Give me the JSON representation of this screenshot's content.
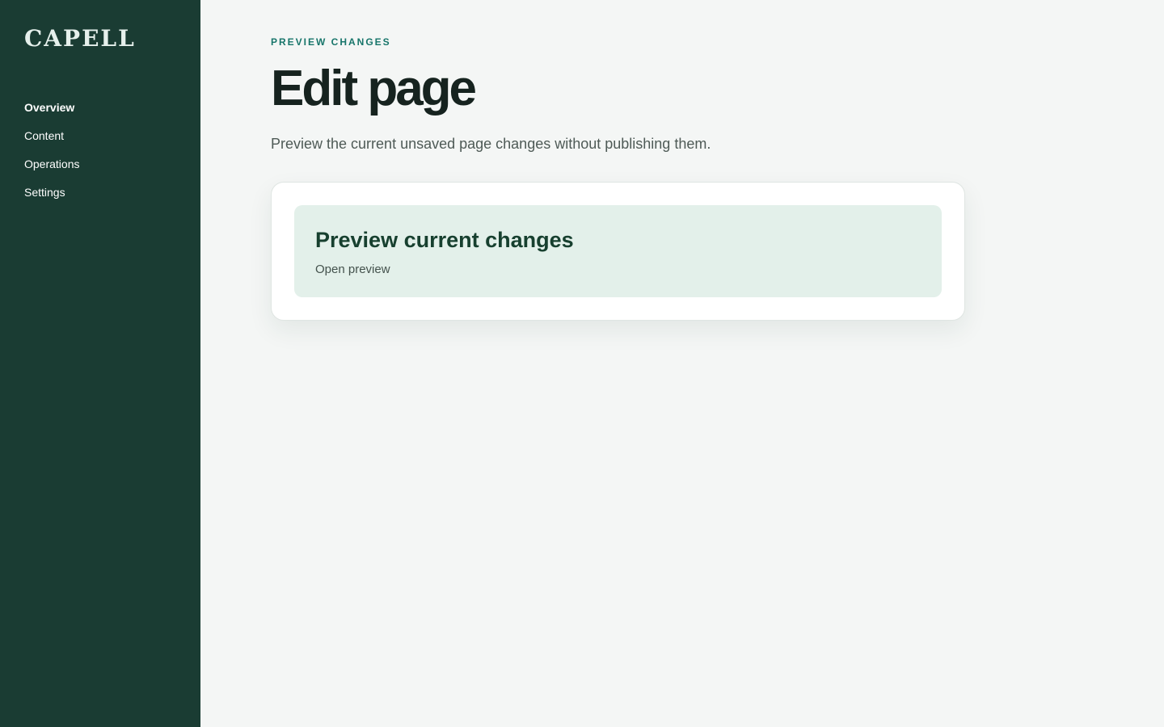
{
  "brand": {
    "name": "CAPELL"
  },
  "sidebar": {
    "items": [
      {
        "label": "Overview",
        "active": true
      },
      {
        "label": "Content",
        "active": false
      },
      {
        "label": "Operations",
        "active": false
      },
      {
        "label": "Settings",
        "active": false
      }
    ]
  },
  "main": {
    "eyebrow": "PREVIEW CHANGES",
    "title": "Edit page",
    "description": "Preview the current unsaved page changes without publishing them.",
    "card": {
      "action_title": "Preview current changes",
      "action_subtitle": "Open preview"
    }
  },
  "colors": {
    "sidebar_bg": "#1a3c33",
    "page_bg": "#f4f6f5",
    "accent": "#17756a",
    "action_bg": "#e3f0ea"
  }
}
